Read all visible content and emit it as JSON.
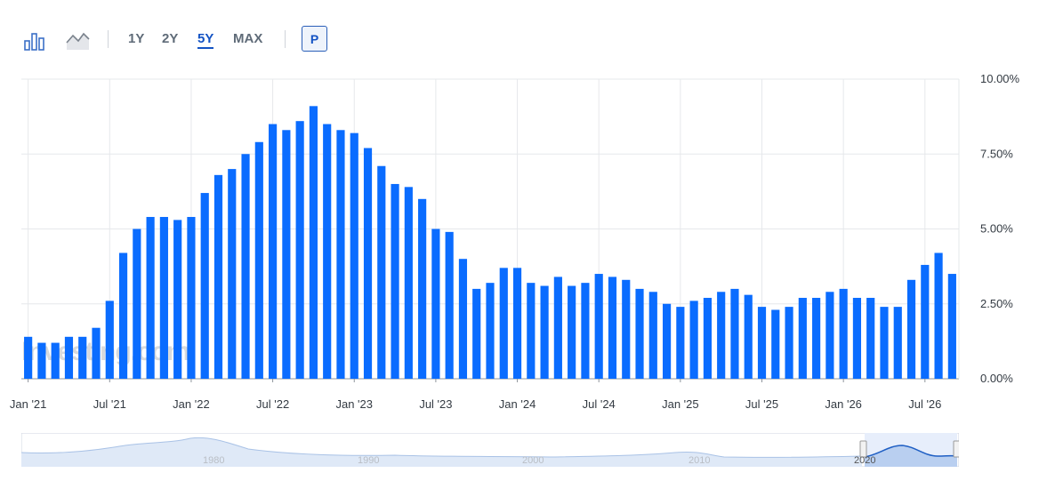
{
  "toolbar": {
    "chart_type_icons": [
      "bar-chart-icon",
      "area-chart-icon"
    ],
    "ranges": [
      "1Y",
      "2Y",
      "5Y",
      "MAX"
    ],
    "active_range": "5Y",
    "p_button": "P"
  },
  "watermark": "Investing.com",
  "colors": {
    "bar": "#0a6cff",
    "active_range": "#1453c4",
    "navigator_line": "#1f5fc4"
  },
  "navigator": {
    "year_labels": [
      "1980",
      "1990",
      "2000",
      "2010",
      "2020"
    ]
  },
  "chart_data": {
    "type": "bar",
    "x_start": "2021-01",
    "x_end": "2026-07",
    "x_tick_labels": [
      "Jan '21",
      "Jul '21",
      "Jan '22",
      "Jul '22",
      "Jan '23",
      "Jul '23",
      "Jan '24",
      "Jul '24",
      "Jan '25",
      "Jul '25",
      "Jan '26",
      "Jul '26"
    ],
    "y_tick_labels": [
      "0.00%",
      "2.50%",
      "5.00%",
      "7.50%",
      "10.00%"
    ],
    "ylim": [
      0,
      10
    ],
    "grid": true,
    "values": [
      1.4,
      1.2,
      1.2,
      1.4,
      1.4,
      1.7,
      2.6,
      4.2,
      5.0,
      5.4,
      5.4,
      5.3,
      5.4,
      6.2,
      6.8,
      7.0,
      7.5,
      7.9,
      8.5,
      8.3,
      8.6,
      9.1,
      8.5,
      8.3,
      8.2,
      7.7,
      7.1,
      6.5,
      6.4,
      6.0,
      5.0,
      4.9,
      4.0,
      3.0,
      3.2,
      3.7,
      3.7,
      3.2,
      3.1,
      3.4,
      3.1,
      3.2,
      3.5,
      3.4,
      3.3,
      3.0,
      2.9,
      2.5,
      2.4,
      2.6,
      2.7,
      2.9,
      3.0,
      2.8,
      2.4,
      2.3,
      2.4,
      2.7,
      2.7,
      2.9,
      3.0,
      2.7,
      2.7,
      2.4,
      2.4,
      3.3,
      3.8,
      4.2,
      3.5
    ]
  }
}
